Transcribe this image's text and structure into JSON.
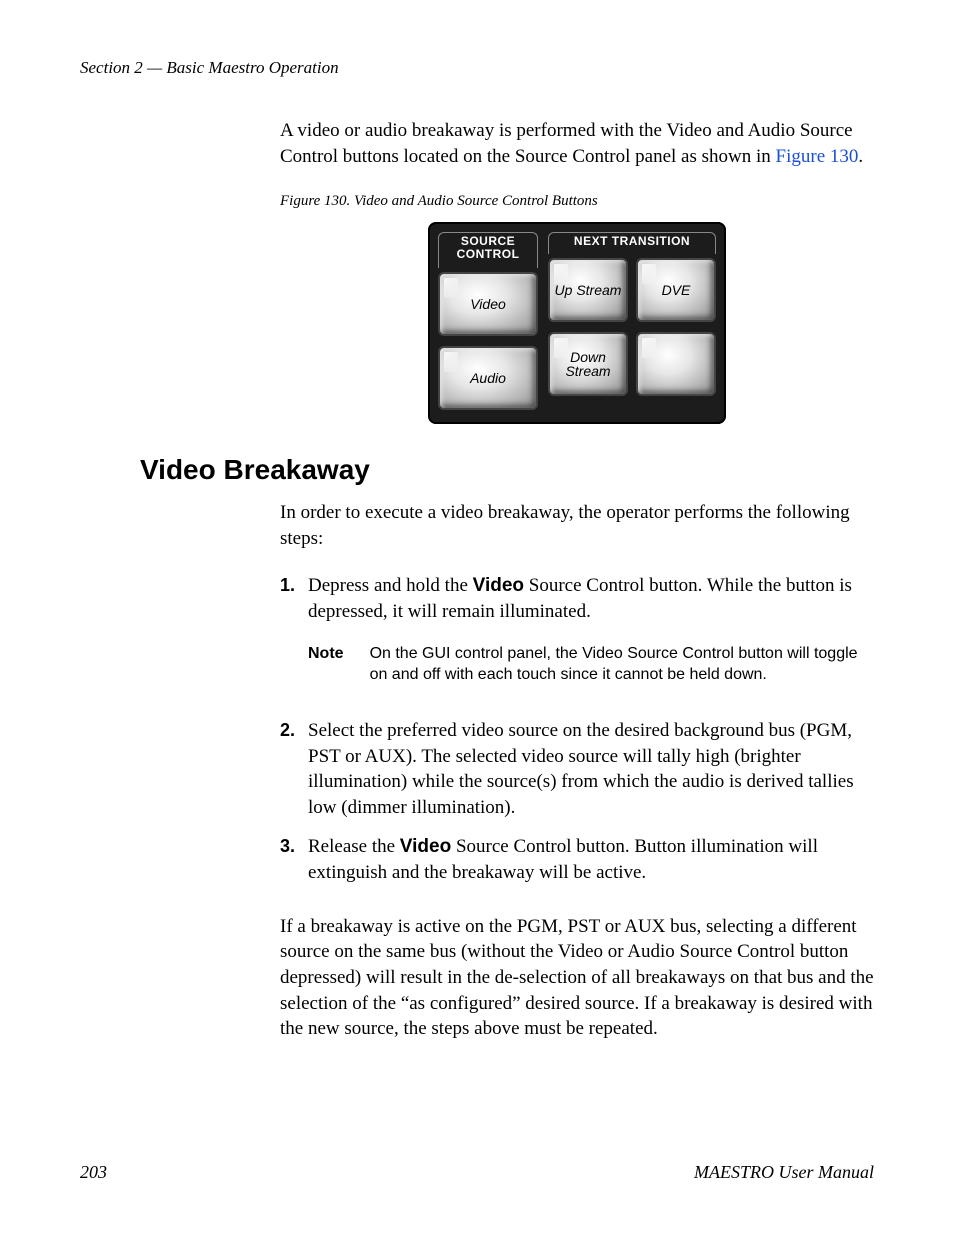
{
  "header": {
    "running_head": "Section 2 — Basic Maestro Operation"
  },
  "intro": {
    "text_before_link": "A video or audio breakaway is performed with the Video and Audio Source Control buttons located on the Source Control panel as shown in ",
    "link_text": "Figure 130",
    "period": "."
  },
  "figure": {
    "caption": "Figure 130.  Video and Audio Source Control Buttons",
    "panel": {
      "source_control_label": "SOURCE CONTROL",
      "next_transition_label": "NEXT TRANSITION",
      "video_btn": "Video",
      "audio_btn": "Audio",
      "up_stream_btn": "Up Stream",
      "dve_btn": "DVE",
      "down_stream_btn": "Down Stream",
      "blank_btn": ""
    }
  },
  "section": {
    "heading": "Video Breakaway",
    "lead": "In order to execute a video breakaway, the operator performs the following steps:",
    "steps": {
      "s1_a": "Depress and hold the ",
      "s1_bold": "Video",
      "s1_b": " Source Control button. While the button is depressed, it will remain illuminated.",
      "note_label": "Note",
      "note_text": "On the GUI control panel, the Video Source Control button will toggle on and off with each touch since it cannot be held down.",
      "s2": "Select the preferred video source on the desired background bus (PGM, PST or AUX). The selected video source will tally high (brighter illumination) while the source(s) from which the audio is derived tallies low (dimmer illumination).",
      "s3_a": "Release the ",
      "s3_bold": "Video",
      "s3_b": " Source Control button. Button illumination will extinguish and the breakaway will be active."
    },
    "closing": "If a breakaway is active on the PGM, PST or AUX bus, selecting a different source on the same bus (without the Video or Audio Source Control button depressed) will result in the de-selection of all breakaways on that bus and the selection of the “as configured” desired source. If a breakaway is desired with the new source, the steps above must be repeated."
  },
  "footer": {
    "page_number": "203",
    "manual_title": "MAESTRO User Manual"
  }
}
